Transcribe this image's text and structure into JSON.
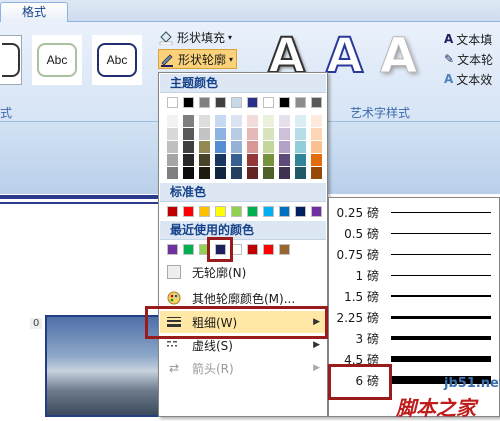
{
  "ribbon": {
    "tab_label": "格式",
    "abc_label": "Abc",
    "shape_fill_label": "形状填充",
    "shape_outline_label": "形状轮廓",
    "art_letter": "A",
    "text_fill_label": "文本填",
    "text_outline_label": "文本轮",
    "text_effects_label": "文本效",
    "group_shape_styles_partial": "式",
    "group_wordart_styles": "艺术字样式"
  },
  "outline_menu": {
    "theme_colors_header": "主题颜色",
    "standard_colors_header": "标准色",
    "recent_colors_header": "最近使用的颜色",
    "theme_colors_top": [
      "#ffffff",
      "#000000",
      "#eeece1",
      "#1f497d",
      "#4f81bd",
      "#c0504d",
      "#9bbb59",
      "#8064a2",
      "#4bacc6",
      "#f79646"
    ],
    "theme_colors_top_display": [
      "#ffffff",
      "#000000",
      "#808080",
      "#404040",
      "#c6d9e8",
      "#2b2f8c",
      "#ffffff",
      "#000000",
      "#8c8c8c",
      "#595959"
    ],
    "standard_colors": [
      "#c00000",
      "#ff0000",
      "#ffc000",
      "#ffff00",
      "#92d050",
      "#00b050",
      "#00b0f0",
      "#0070c0",
      "#002060",
      "#7030a0"
    ],
    "recent_colors": [
      "#7030a0",
      "#00b050",
      "#92d050",
      "#1f1f5f",
      "#ffffff",
      "#c00000",
      "#ff0000",
      "#996633"
    ],
    "no_outline_label": "无轮廓(N)",
    "more_colors_label": "其他轮廓颜色(M)...",
    "weight_label": "粗细(W)",
    "dash_label": "虚线(S)",
    "arrows_label": "箭头(R)"
  },
  "weight_menu": {
    "items": [
      {
        "label": "0.25 磅",
        "weight_pt": 0.25
      },
      {
        "label": "0.5 磅",
        "weight_pt": 0.5
      },
      {
        "label": "0.75 磅",
        "weight_pt": 0.75
      },
      {
        "label": "1 磅",
        "weight_pt": 1
      },
      {
        "label": "1.5 磅",
        "weight_pt": 1.5
      },
      {
        "label": "2.25 磅",
        "weight_pt": 2.25
      },
      {
        "label": "3 磅",
        "weight_pt": 3
      },
      {
        "label": "4.5 磅",
        "weight_pt": 4.5
      },
      {
        "label": "6 磅",
        "weight_pt": 6
      }
    ]
  },
  "document": {
    "zero_marker": "0"
  },
  "watermark": {
    "site": "jb51.net",
    "name": "脚本之家"
  },
  "colors": {
    "highlight_border": "#9a1b1b",
    "ribbon_text": "#15428b"
  }
}
